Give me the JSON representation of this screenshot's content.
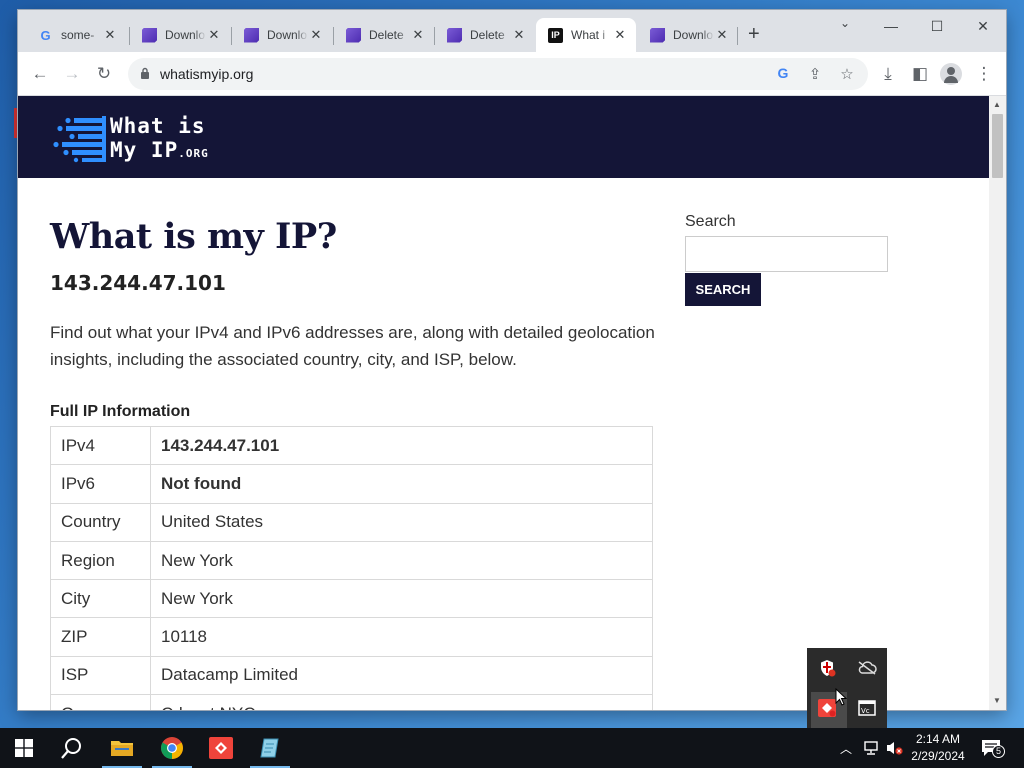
{
  "browser": {
    "tabs": [
      {
        "title": "some-",
        "favicon": "google-icon",
        "active": false
      },
      {
        "title": "Downlo",
        "favicon": "document-icon",
        "active": false
      },
      {
        "title": "Downlo",
        "favicon": "document-icon",
        "active": false
      },
      {
        "title": "Delete",
        "favicon": "document-icon",
        "active": false
      },
      {
        "title": "Delete",
        "favicon": "document-icon",
        "active": false
      },
      {
        "title": "What i",
        "favicon": "ip-icon",
        "active": true
      },
      {
        "title": "Downlo",
        "favicon": "document-icon",
        "active": false
      }
    ],
    "new_tab_label": "+",
    "url": "whatismyip.org"
  },
  "site": {
    "logo_line1": "What is",
    "logo_line2": "My IP",
    "logo_suffix": ".ORG",
    "heading": "What is my IP?",
    "ip": "143.244.47.101",
    "intro": "Find out what your IPv4 and IPv6 addresses are, along with detailed geolocation insights, including the associated country, city, and ISP, below.",
    "section_title": "Full IP Information",
    "rows": [
      {
        "label": "IPv4",
        "value": "143.244.47.101"
      },
      {
        "label": "IPv6",
        "value": "Not found"
      },
      {
        "label": "Country",
        "value": "United States"
      },
      {
        "label": "Region",
        "value": "New York"
      },
      {
        "label": "City",
        "value": "New York"
      },
      {
        "label": "ZIP",
        "value": "10118"
      },
      {
        "label": "ISP",
        "value": "Datacamp Limited"
      },
      {
        "label": "Org",
        "value": "Cdnext NYC"
      }
    ],
    "search_label": "Search",
    "search_button": "SEARCH"
  },
  "taskbar": {
    "time": "2:14 AM",
    "date": "2/29/2024",
    "notification_count": "5"
  },
  "colors": {
    "brand_navy": "#141537",
    "logo_blue": "#2f8fff"
  }
}
